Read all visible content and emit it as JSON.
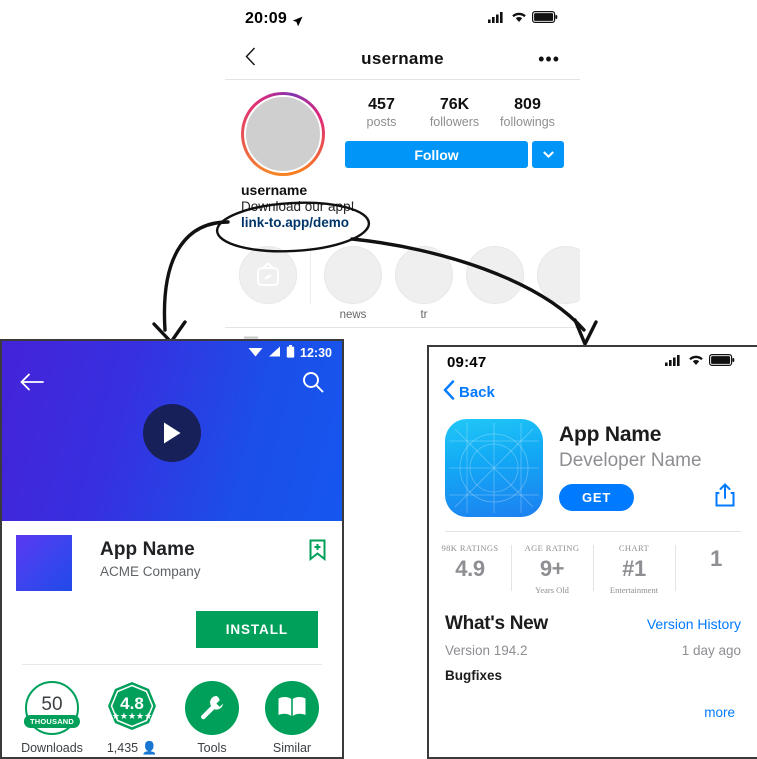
{
  "instagram": {
    "statusbar": {
      "time": "20:09",
      "location_icon": "location-arrow-icon",
      "signal_icon": "cellular-signal-icon",
      "wifi_icon": "wifi-icon",
      "battery_icon": "battery-icon"
    },
    "navbar": {
      "back_icon": "chevron-left-icon",
      "title": "username",
      "more_icon": "ellipsis-icon"
    },
    "avatar": "profile-avatar",
    "stats": [
      {
        "value": "457",
        "label": "posts"
      },
      {
        "value": "76K",
        "label": "followers"
      },
      {
        "value": "809",
        "label": "followings"
      }
    ],
    "follow_button": "Follow",
    "follow_dropdown_icon": "chevron-down-icon",
    "accent_blue": "#0095f6",
    "bio": {
      "name": "username",
      "text": "Download our app!",
      "link": "link-to.app/demo"
    },
    "highlights": [
      {
        "label": "",
        "icon": "igtv-icon"
      },
      {
        "label": "news",
        "icon": ""
      },
      {
        "label": "tr",
        "icon": ""
      },
      {
        "label": "",
        "icon": ""
      },
      {
        "label": "",
        "icon": ""
      }
    ],
    "grid_tab_icon": "grid-post-icon"
  },
  "android": {
    "sysbar": {
      "wifi_icon": "wifi-icon",
      "signal_icon": "cellular-signal-icon",
      "battery_icon": "battery-icon",
      "time": "12:30"
    },
    "back_icon": "arrow-left-icon",
    "search_icon": "search-icon",
    "play_icon": "play-button-icon",
    "app_name": "App Name",
    "developer": "ACME Company",
    "bookmark_icon": "bookmark-add-icon",
    "install_button": "INSTALL",
    "accent_green": "#00a05a",
    "stats": [
      {
        "value": "50",
        "pill": "THOUSAND",
        "label": "Downloads",
        "icon": "downloads-ring-icon"
      },
      {
        "value": "4.8",
        "stars": "★★★★★",
        "label": "1,435",
        "label_icon": "person-icon",
        "icon": "rating-badge-icon"
      },
      {
        "value": "",
        "label": "Tools",
        "icon": "wrench-icon"
      },
      {
        "value": "",
        "label": "Similar",
        "icon": "books-icon"
      }
    ]
  },
  "ios": {
    "statusbar": {
      "time": "09:47",
      "signal_icon": "cellular-signal-icon",
      "wifi_icon": "wifi-icon",
      "battery_icon": "battery-icon"
    },
    "back_icon": "chevron-left-icon",
    "back_label": "Back",
    "app_icon": "app-icon-template",
    "app_name": "App Name",
    "developer": "Developer Name",
    "get_button": "GET",
    "share_icon": "share-icon",
    "accent_blue": "#007aff",
    "stats": [
      {
        "caption": "98k RATINGS",
        "value": "4.9",
        "sub": ""
      },
      {
        "caption": "AGE RATING",
        "value": "9+",
        "sub": "Years Old"
      },
      {
        "caption": "CHART",
        "value": "#1",
        "sub": "Entertainment"
      },
      {
        "caption": "",
        "value": "1",
        "sub": ""
      }
    ],
    "whats_new": {
      "title": "What's New",
      "version_history_link": "Version History",
      "version": "Version 194.2",
      "ago": "1 day ago",
      "notes": "Bugfixes",
      "more_link": "more"
    }
  },
  "annotations": {
    "ellipse": "hand-drawn-ellipse-highlight",
    "arrow_left": "arrow-to-android-panel",
    "arrow_right": "arrow-to-ios-panel"
  }
}
